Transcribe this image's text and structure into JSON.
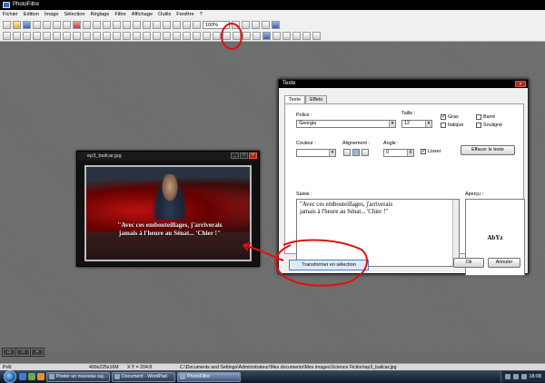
{
  "app": {
    "title": "PhotoFiltre"
  },
  "menu": [
    "Fichier",
    "Edition",
    "Image",
    "Sélection",
    "Réglage",
    "Filtre",
    "Affichage",
    "Outils",
    "Fenêtre",
    "?"
  ],
  "toolbar": {
    "zoom": "100%"
  },
  "image_window": {
    "title": "ep3_bailcar.jpg",
    "caption_line1": "\"Avec ces embouteillages, j'arriverais",
    "caption_line2": "jamais à l'heure au Sénat... 'Chier !\""
  },
  "text_dialog": {
    "title": "Texte",
    "tabs": [
      "Texte",
      "Effets"
    ],
    "police_label": "Police :",
    "police_value": "Georgia",
    "taille_label": "Taille :",
    "taille_value": "12",
    "gras": "Gras",
    "italique": "Italique",
    "barre": "Barré",
    "souligne": "Souligné",
    "couleur_label": "Couleur :",
    "alignement_label": "Alignement :",
    "angle_label": "Angle :",
    "angle_value": "0",
    "lisser": "Lisser",
    "effacer": "Effacer le texte",
    "saisie_label": "Saisie :",
    "saisie_line1": "\"Avec ces embouteillages, j'arriverais",
    "saisie_line2": "jamais à l'heure au Sénat... 'Chier !\"",
    "apercu_label": "Aperçu :",
    "apercu_text": "AbYz",
    "ok": "Ok",
    "annuler": "Annuler"
  },
  "transform_button": "Transformer en sélection",
  "status": {
    "state": "Prêt",
    "dims": "400x225x16M",
    "coords": "X:Y = 204:8",
    "path": "C:\\Documents and Settings\\Administrateur\\Mes documents\\Mes images\\Science Fiction\\ep3_bailcar.jpg"
  },
  "taskbar": {
    "tasks": [
      "Poster un nouveau suj...",
      "Document - WordPad",
      "PhotoFiltre"
    ],
    "clock": "18:08"
  },
  "colors": {
    "annotation": "#e01010",
    "workspace": "#6c6c6c"
  }
}
